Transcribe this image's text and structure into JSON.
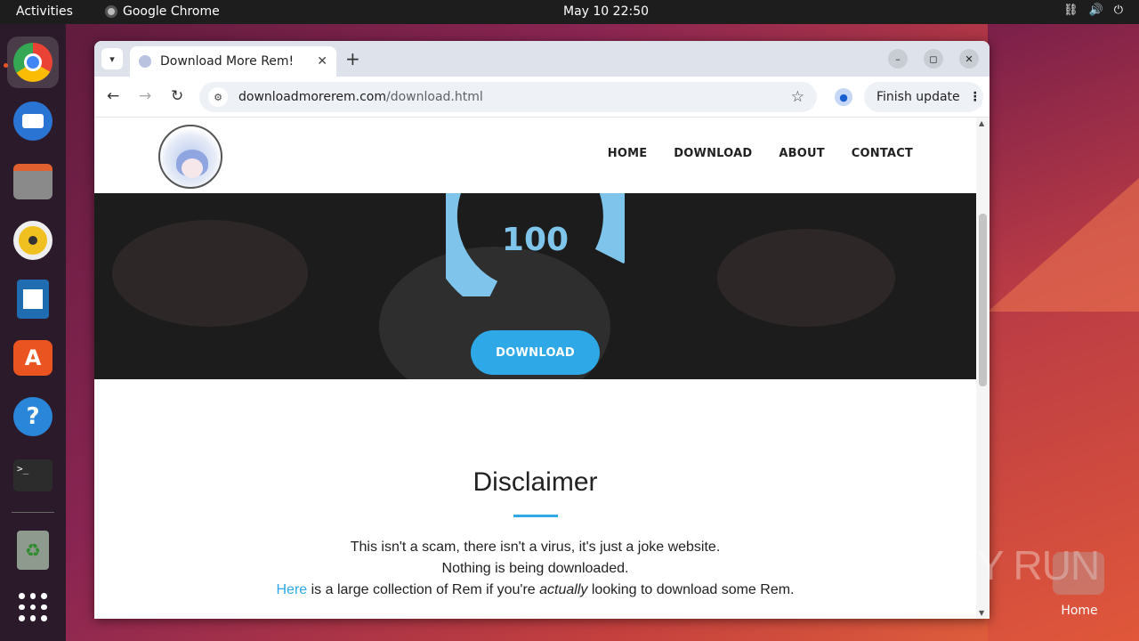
{
  "topbar": {
    "activities": "Activities",
    "app_name": "Google Chrome",
    "clock": "May 10  22:50"
  },
  "browser": {
    "tab_title": "Download More Rem!",
    "url_host": "downloadmorerem.com",
    "url_path": "/download.html",
    "finish_update": "Finish update"
  },
  "site": {
    "nav": [
      "HOME",
      "DOWNLOAD",
      "ABOUT",
      "CONTACT"
    ],
    "gauge_value": "100",
    "download_button": "DOWNLOAD",
    "disclaimer_title": "Disclaimer",
    "disclaimer_line1": "This isn't a scam, there isn't a virus, it's just a joke website.",
    "disclaimer_line2": "Nothing is being downloaded.",
    "disclaimer_link": "Here",
    "disclaimer_line3_a": " is a large collection of Rem if you're ",
    "disclaimer_line3_em": "actually",
    "disclaimer_line3_b": " looking to download some Rem."
  },
  "desktop": {
    "watermark": "ANY RUN",
    "home_label": "Home"
  },
  "colors": {
    "accent": "#2ea8e6",
    "gauge": "#7fc4ea"
  }
}
